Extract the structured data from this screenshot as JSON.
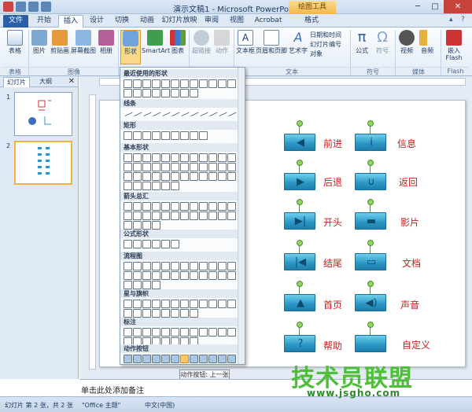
{
  "window": {
    "title": "演示文稿1 - Microsoft PowerPoint",
    "context_tab": "绘图工具"
  },
  "tabs": [
    {
      "label": "文件"
    },
    {
      "label": "开始"
    },
    {
      "label": "插入"
    },
    {
      "label": "设计"
    },
    {
      "label": "切换"
    },
    {
      "label": "动画"
    },
    {
      "label": "幻灯片放映"
    },
    {
      "label": "审阅"
    },
    {
      "label": "视图"
    },
    {
      "label": "Acrobat"
    },
    {
      "label": "格式"
    }
  ],
  "ribbon": {
    "buttons": [
      {
        "label": "表格"
      },
      {
        "label": "图片"
      },
      {
        "label": "剪贴画"
      },
      {
        "label": "屏幕截图"
      },
      {
        "label": "相册"
      },
      {
        "label": "形状"
      },
      {
        "label": "SmartArt"
      },
      {
        "label": "图表"
      },
      {
        "label": "超链接"
      },
      {
        "label": "动作"
      },
      {
        "label": "文本框"
      },
      {
        "label": "页眉和页脚"
      },
      {
        "label": "艺术字"
      },
      {
        "label": "公式"
      },
      {
        "label": "符号"
      },
      {
        "label": "视频"
      },
      {
        "label": "音频"
      },
      {
        "label": "嵌入 Flash"
      }
    ],
    "small_buttons": [
      {
        "label": "日期和时间"
      },
      {
        "label": "幻灯片编号"
      },
      {
        "label": "对象"
      }
    ],
    "groups": [
      {
        "label": "表格"
      },
      {
        "label": "图像"
      },
      {
        "label": "文本"
      },
      {
        "label": "符号"
      },
      {
        "label": "媒体"
      },
      {
        "label": "Flash"
      }
    ]
  },
  "gallery": {
    "sections": [
      {
        "title": "最近使用的形状"
      },
      {
        "title": "线条"
      },
      {
        "title": "矩形"
      },
      {
        "title": "基本形状"
      },
      {
        "title": "箭头总汇"
      },
      {
        "title": "公式形状"
      },
      {
        "title": "流程图"
      },
      {
        "title": "星与旗帜"
      },
      {
        "title": "标注"
      },
      {
        "title": "动作按钮"
      }
    ],
    "tooltip": "动作按钮: 上一张"
  },
  "slide_pane": {
    "tabs": [
      "幻灯片",
      "大纲"
    ],
    "slides": [
      {
        "num": "1"
      },
      {
        "num": "2"
      }
    ]
  },
  "slide": {
    "buttons": [
      {
        "label": "前进",
        "sym": "◀"
      },
      {
        "label": "信息",
        "sym": "i"
      },
      {
        "label": "后退",
        "sym": "▶"
      },
      {
        "label": "返回",
        "sym": "∪"
      },
      {
        "label": "开头",
        "sym": "▶|"
      },
      {
        "label": "影片",
        "sym": "▬"
      },
      {
        "label": "结尾",
        "sym": "|◀"
      },
      {
        "label": "文档",
        "sym": "▭"
      },
      {
        "label": "首页",
        "sym": "▲"
      },
      {
        "label": "声音",
        "sym": "◀)"
      },
      {
        "label": "帮助",
        "sym": "?"
      },
      {
        "label": "自定义",
        "sym": ""
      }
    ]
  },
  "notes": "单击此处添加备注",
  "status": {
    "slide": "幻灯片 第 2 张，共 2 张",
    "theme": "\"Office 主题\"",
    "lang": "中文(中国)"
  },
  "watermark": {
    "line1": "技术员联盟",
    "line2": "www.jsgho.com"
  }
}
